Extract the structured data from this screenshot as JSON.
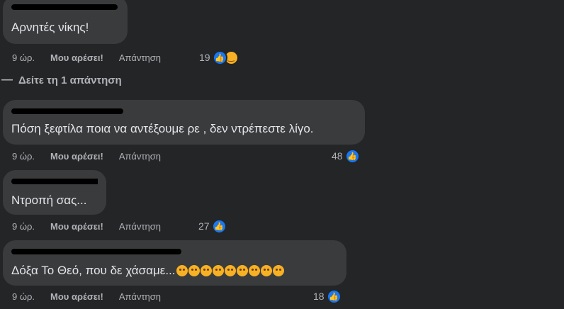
{
  "comments": [
    {
      "text": "Αρνητές νίκης!",
      "time": "9 ώρ.",
      "like_label": "Μου αρέσει!",
      "reply_label": "Απάντηση",
      "reactions_count": "19",
      "reactions": [
        "like-icon",
        "haha-icon"
      ]
    },
    {
      "text": "Πόση ξεφτίλα ποια να αντέξουμε ρε , δεν ντρέπεστε λίγο.",
      "time": "9 ώρ.",
      "like_label": "Μου αρέσει!",
      "reply_label": "Απάντηση",
      "reactions_count": "48",
      "reactions": [
        "like-icon"
      ]
    },
    {
      "text": "Ντροπή σας...",
      "time": "9 ώρ.",
      "like_label": "Μου αρέσει!",
      "reply_label": "Απάντηση",
      "reactions_count": "27",
      "reactions": [
        "like-icon"
      ]
    },
    {
      "text": "Δόξα Το Θεό, που δε χάσαμε...",
      "time": "9 ώρ.",
      "like_label": "Μου αρέσει!",
      "reply_label": "Απάντηση",
      "reactions_count": "18",
      "reactions": [
        "like-icon"
      ],
      "trailing_emojis": [
        "flushed-face",
        "flushed-face",
        "thinking-face",
        "thinking-face",
        "crying-face",
        "crying-face",
        "frowning-face",
        "frowning-face",
        "upside-down-face"
      ]
    }
  ],
  "view_replies": {
    "label": "Δείτε τη 1 απάντηση"
  },
  "colors": {
    "background": "#242526",
    "bubble": "#3a3b3c",
    "text": "#e4e6eb",
    "secondary": "#b0b3b8",
    "like_blue": "#1877f2",
    "haha_yellow": "#f7b125"
  }
}
